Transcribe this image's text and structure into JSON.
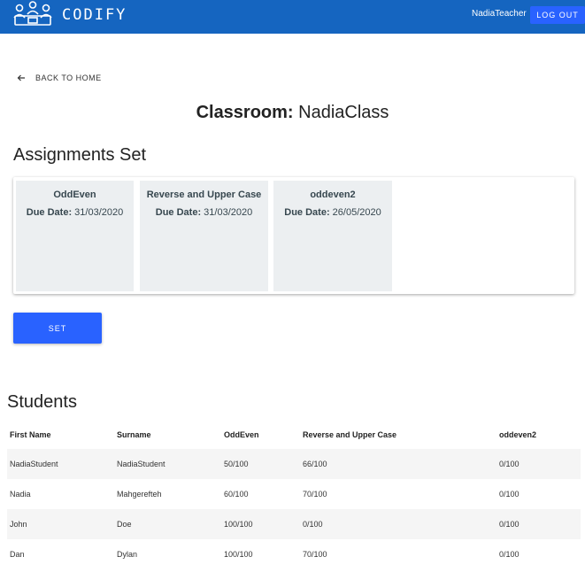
{
  "appbar": {
    "brand": "CODIFY",
    "logo_icon": "people-group-logo-icon",
    "user_name": "NadiaTeacher",
    "logout_label": "LOG OUT"
  },
  "back": {
    "label": "BACK TO HOME",
    "icon": "arrow-left-icon"
  },
  "title": {
    "prefix": "Classroom:",
    "class_name": "NadiaClass"
  },
  "assignments": {
    "heading": "Assignments Set",
    "due_label": "Due Date:",
    "items": [
      {
        "name": "OddEven",
        "due": "31/03/2020"
      },
      {
        "name": "Reverse and Upper Case",
        "due": "31/03/2020"
      },
      {
        "name": "oddeven2",
        "due": "26/05/2020"
      }
    ]
  },
  "set_button": {
    "label": "SET"
  },
  "students": {
    "heading": "Students",
    "columns": [
      "First Name",
      "Surname",
      "OddEven",
      "Reverse and Upper Case",
      "oddeven2"
    ],
    "rows": [
      [
        "NadiaStudent",
        "NadiaStudent",
        "50/100",
        "66/100",
        "0/100"
      ],
      [
        "Nadia",
        "Mahgerefteh",
        "60/100",
        "70/100",
        "0/100"
      ],
      [
        "John",
        "Doe",
        "100/100",
        "0/100",
        "0/100"
      ],
      [
        "Dan",
        "Dylan",
        "100/100",
        "70/100",
        "0/100"
      ]
    ]
  },
  "colors": {
    "appbar": "#1565c0",
    "button": "#2962ff",
    "card": "#eceff1",
    "row_alt": "#f5f5f5"
  }
}
